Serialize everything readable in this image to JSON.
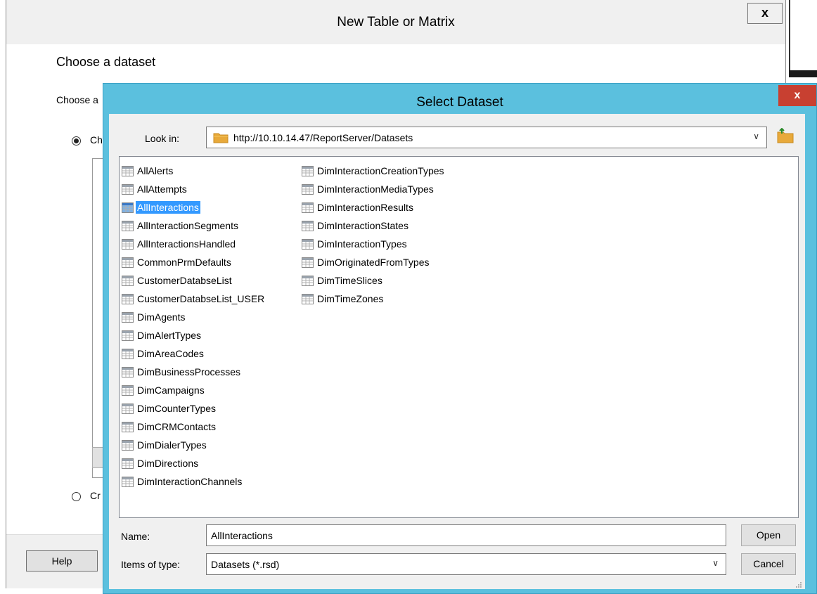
{
  "background_window": {
    "title": "New Table or Matrix",
    "close_label": "x",
    "heading": "Choose a dataset",
    "subheading": "Choose a",
    "radio1_label": "Ch",
    "radio2_label": "Cr",
    "help_label": "Help"
  },
  "dialog": {
    "title": "Select Dataset",
    "close_label": "x",
    "look_in_label": "Look in:",
    "look_in_value": "http://10.10.14.47/ReportServer/Datasets",
    "files_column1": [
      "AllAlerts",
      "AllAttempts",
      "AllInteractions",
      "AllInteractionSegments",
      "AllInteractionsHandled",
      "CommonPrmDefaults",
      "CustomerDatabseList",
      "CustomerDatabseList_USER",
      "DimAgents",
      "DimAlertTypes",
      "DimAreaCodes",
      "DimBusinessProcesses",
      "DimCampaigns",
      "DimCounterTypes",
      "DimCRMContacts",
      "DimDialerTypes",
      "DimDirections",
      "DimInteractionChannels"
    ],
    "files_column2": [
      "DimInteractionCreationTypes",
      "DimInteractionMediaTypes",
      "DimInteractionResults",
      "DimInteractionStates",
      "DimInteractionTypes",
      "DimOriginatedFromTypes",
      "DimTimeSlices",
      "DimTimeZones"
    ],
    "selected_file": "AllInteractions",
    "name_label": "Name:",
    "name_value": "AllInteractions",
    "type_label": "Items of type:",
    "type_value": "Datasets (*.rsd)",
    "open_label": "Open",
    "cancel_label": "Cancel"
  },
  "colors": {
    "dialog_frame": "#5bc0de",
    "close_button": "#c84031",
    "selection": "#3399ff",
    "folder": "#e8a93a"
  }
}
